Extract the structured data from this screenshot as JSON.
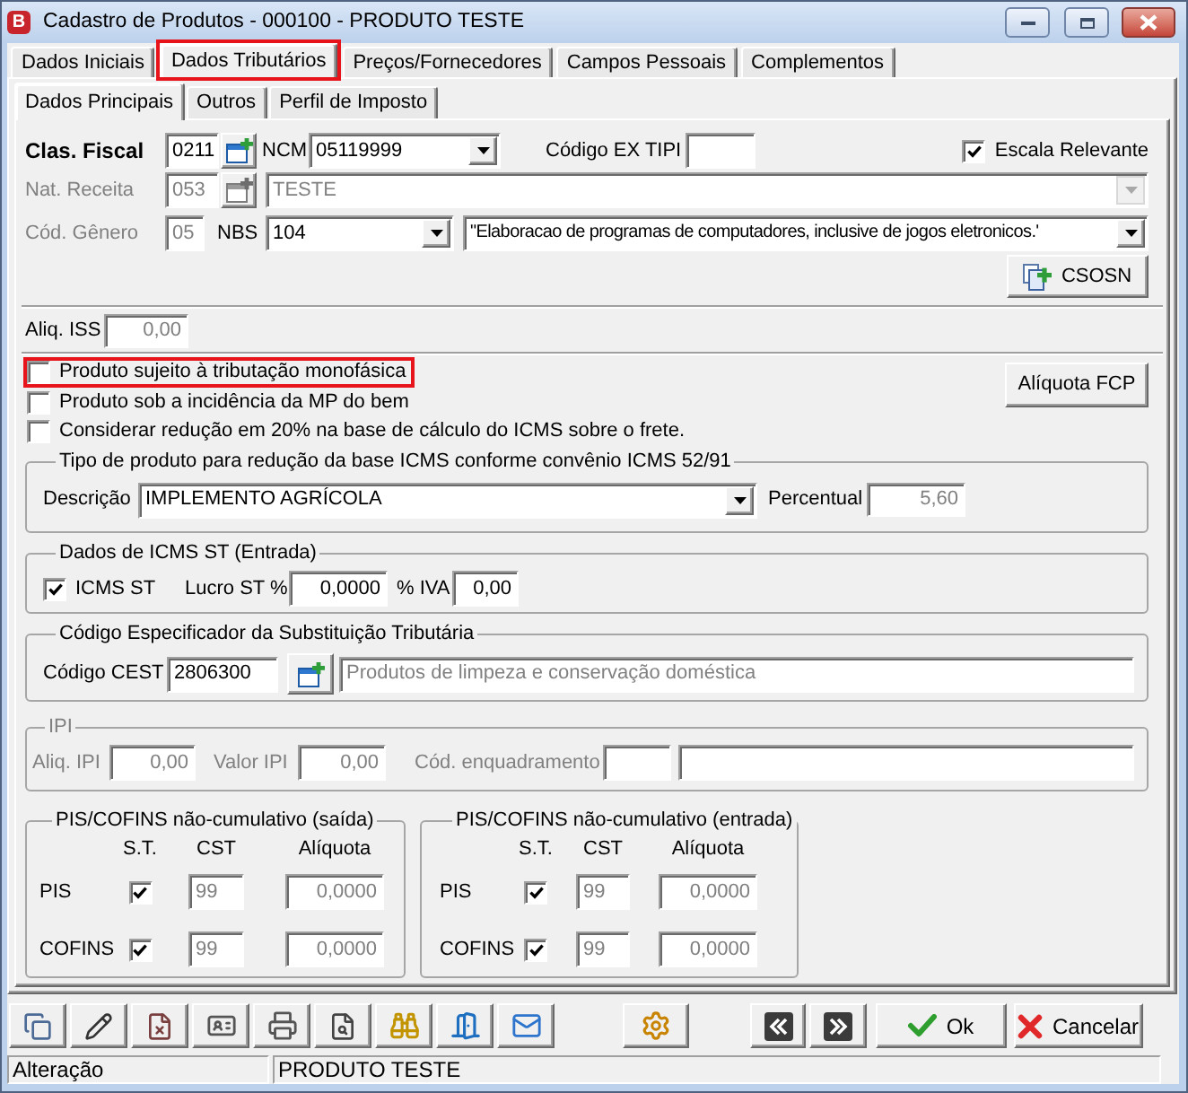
{
  "window": {
    "icon_letter": "B",
    "title": "Cadastro de Produtos - 000100 - PRODUTO TESTE"
  },
  "tabs": [
    {
      "label": "Dados Iniciais",
      "selected": false,
      "highlighted": false
    },
    {
      "label": "Dados Tributários",
      "selected": true,
      "highlighted": true
    },
    {
      "label": "Preços/Fornecedores",
      "selected": false,
      "highlighted": false
    },
    {
      "label": "Campos Pessoais",
      "selected": false,
      "highlighted": false
    },
    {
      "label": "Complementos",
      "selected": false,
      "highlighted": false
    }
  ],
  "subtabs": [
    {
      "label": "Dados Principais",
      "selected": true
    },
    {
      "label": "Outros",
      "selected": false
    },
    {
      "label": "Perfil de Imposto",
      "selected": false
    }
  ],
  "clas_fiscal": {
    "label": "Clas. Fiscal",
    "value": "0211"
  },
  "ncm": {
    "label": "NCM",
    "value": "05119999"
  },
  "codigo_ex_tipi": {
    "label": "Código EX TIPI"
  },
  "escala_relevante": {
    "label": "Escala Relevante",
    "checked": true
  },
  "nat_receita": {
    "label": "Nat. Receita",
    "value": "053",
    "description": "TESTE",
    "disabled": true
  },
  "cod_genero": {
    "label": "Cód. Gênero",
    "value": "05",
    "disabled": true
  },
  "nbs": {
    "label": "NBS",
    "value": "104",
    "description": "\"Elaboracao de programas de computadores, inclusive de jogos eletronicos.'"
  },
  "csosn_button": {
    "label": "CSOSN"
  },
  "aliq_iss": {
    "label": "Aliq. ISS",
    "value": "0,00",
    "disabled": true
  },
  "options": [
    {
      "label": "Produto sujeito à tributação monofásica",
      "checked": false,
      "highlighted": true
    },
    {
      "label": "Produto sob a incidência da MP do bem",
      "checked": false,
      "highlighted": false
    },
    {
      "label": "Considerar redução em 20% na base de cálculo do ICMS sobre o frete.",
      "checked": false,
      "highlighted": false
    }
  ],
  "fcp_button": {
    "label": "Alíquota FCP"
  },
  "reducao_base": {
    "title": "Tipo de produto para redução da base ICMS conforme convênio ICMS 52/91",
    "descricao_label": "Descrição",
    "descricao": "IMPLEMENTO AGRÍCOLA",
    "percentual_label": "Percentual",
    "percentual": "5,60",
    "percentual_disabled": true
  },
  "icms_st": {
    "title": "Dados de ICMS ST (Entrada)",
    "checkbox": {
      "label": "ICMS ST",
      "checked": true
    },
    "lucro_label": "Lucro ST %",
    "lucro": "0,0000",
    "iva_label": "% IVA",
    "iva": "0,00"
  },
  "cest": {
    "title": "Código Especificador da Substituição Tributária",
    "label": "Código CEST",
    "value": "2806300",
    "description": "Produtos de limpeza e conservação doméstica",
    "description_disabled": true
  },
  "ipi": {
    "title": "IPI",
    "disabled": true,
    "aliq_label": "Aliq. IPI",
    "aliq": "0,00",
    "valor_label": "Valor IPI",
    "valor": "0,00",
    "enquadramento_label": "Cód. enquadramento"
  },
  "pis_cofins": [
    {
      "title": "PIS/COFINS não-cumulativo (saída)",
      "columns": [
        "S.T.",
        "CST",
        "Alíquota"
      ],
      "fields_disabled": true,
      "rows": [
        {
          "label": "PIS",
          "st": true,
          "cst": "99",
          "aliquota": "0,0000"
        },
        {
          "label": "COFINS",
          "st": true,
          "cst": "99",
          "aliquota": "0,0000"
        }
      ]
    },
    {
      "title": "PIS/COFINS não-cumulativo (entrada)",
      "columns": [
        "S.T.",
        "CST",
        "Alíquota"
      ],
      "fields_disabled": true,
      "rows": [
        {
          "label": "PIS",
          "st": true,
          "cst": "99",
          "aliquota": "0,0000"
        },
        {
          "label": "COFINS",
          "st": true,
          "cst": "99",
          "aliquota": "0,0000"
        }
      ]
    }
  ],
  "actions": [
    {
      "kind": "ok",
      "label": "Ok"
    },
    {
      "kind": "cancel",
      "label": "Cancelar"
    }
  ],
  "status_bar": [
    "Alteração",
    "PRODUTO TESTE"
  ]
}
